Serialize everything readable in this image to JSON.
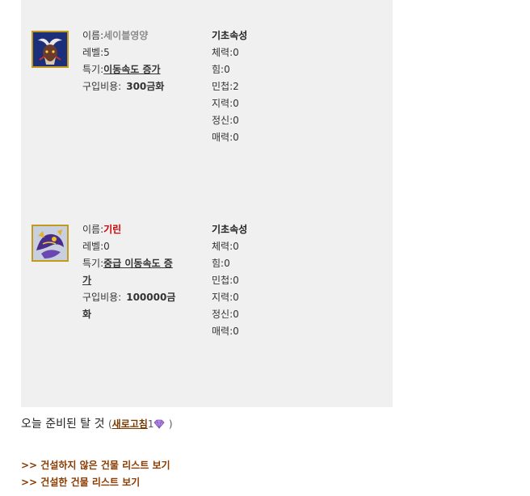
{
  "cards": [
    {
      "name_label": "이름:",
      "name": "세이블영양",
      "level_label": "레벨:",
      "level": "5",
      "skill_label": "특기:",
      "skill": "이동속도 증가",
      "cost_label": "구입비용:",
      "cost": "300금화",
      "attr_title": "기초속성",
      "attrs": [
        "체력:0",
        "힘:0",
        "민첩:2",
        "지력:0",
        "정신:0",
        "매력:0"
      ]
    },
    {
      "name_label": "이름:",
      "name": "기린",
      "level_label": "레벨:",
      "level": "0",
      "skill_label": "특기:",
      "skill_line1": "중급 이동속도 증",
      "skill_line2": "가",
      "cost_label": "구입비용:",
      "cost_line1": "100000금",
      "cost_line2": "화",
      "attr_title": "기초속성",
      "attrs": [
        "체력:0",
        "힘:0",
        "민첩:0",
        "지력:0",
        "정신:0",
        "매력:0"
      ]
    }
  ],
  "today": {
    "title": "오늘 준비된 탈 것",
    "paren_open": "(",
    "refresh": "새로고침",
    "count": "1",
    "paren_close": ")"
  },
  "links": [
    ">> 건설하지 않은 건물 리스트 보기",
    ">> 건설한 건물 리스트 보기"
  ],
  "icons": {
    "gem": "diamond-gem-icon"
  }
}
